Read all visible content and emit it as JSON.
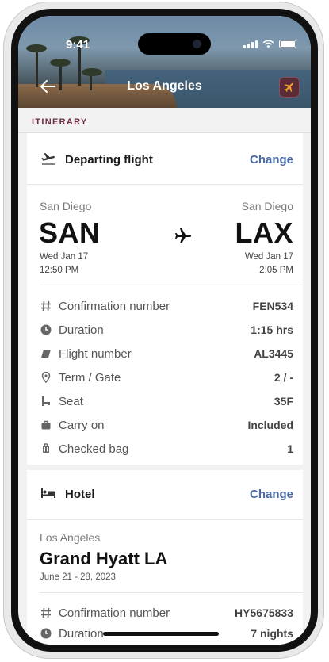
{
  "status_bar": {
    "time": "9:41"
  },
  "header": {
    "title": "Los Angeles"
  },
  "section": {
    "label": "ITINERARY"
  },
  "flight": {
    "title": "Departing flight",
    "change_label": "Change",
    "origin": {
      "city": "San Diego",
      "code": "SAN",
      "date": "Wed Jan 17",
      "time": "12:50 PM"
    },
    "destination": {
      "city": "San Diego",
      "code": "LAX",
      "date": "Wed Jan 17",
      "time": "2:05 PM"
    },
    "details": [
      {
        "icon": "hash-icon",
        "label": "Confirmation number",
        "value": "FEN534"
      },
      {
        "icon": "clock-icon",
        "label": "Duration",
        "value": "1:15 hrs"
      },
      {
        "icon": "plane-tag-icon",
        "label": "Flight number",
        "value": "AL3445"
      },
      {
        "icon": "location-pin-icon",
        "label": "Term / Gate",
        "value": "2 / -"
      },
      {
        "icon": "seat-icon",
        "label": "Seat",
        "value": "35F"
      },
      {
        "icon": "briefcase-icon",
        "label": "Carry on",
        "value": "Included"
      },
      {
        "icon": "luggage-icon",
        "label": "Checked bag",
        "value": "1"
      }
    ]
  },
  "hotel": {
    "title": "Hotel",
    "change_label": "Change",
    "city": "Los Angeles",
    "name": "Grand Hyatt LA",
    "dates": "June 21 - 28, 2023",
    "details": [
      {
        "icon": "hash-icon",
        "label": "Confirmation number",
        "value": "HY5675833"
      },
      {
        "icon": "clock-icon",
        "label": "Duration",
        "value": "7 nights"
      }
    ]
  },
  "colors": {
    "accent": "#4a6aa6",
    "section_label": "#6b2d3d",
    "badge": "#5b2b38"
  }
}
